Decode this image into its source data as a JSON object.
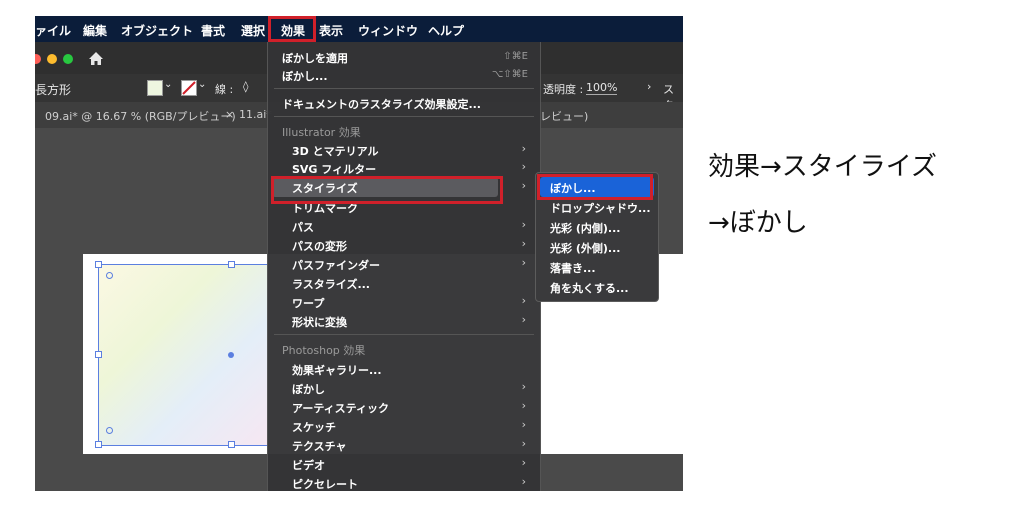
{
  "menubar": {
    "items": [
      "ァイル",
      "編集",
      "オブジェクト",
      "書式",
      "選択",
      "効果",
      "表示",
      "ウィンドウ",
      "ヘルプ"
    ]
  },
  "toolbar": {
    "shape_label": "長方形",
    "stroke_label": "線 :",
    "stroke_stepper": "◊",
    "opacity_label": "透明度 :",
    "opacity_value": "100%",
    "style_label": "スタ"
  },
  "tabs": {
    "tab1": "09.ai* @ 16.67 % (RGB/プレビュー)",
    "tab2_close": "×",
    "tab2": "11.ai*",
    "tab3_tail": "レビュー)"
  },
  "effect_menu": {
    "apply_blur": "ぼかしを適用",
    "apply_blur_shortcut": "⇧⌘E",
    "blur_dialog": "ぼかし...",
    "blur_dialog_shortcut": "⌥⇧⌘E",
    "doc_raster": "ドキュメントのラスタライズ効果設定...",
    "illustrator_header": "Illustrator 効果",
    "illustrator_items": [
      "3D とマテリアル",
      "SVG フィルター",
      "スタイライズ",
      "トリムマーク",
      "パス",
      "パスの変形",
      "パスファインダー",
      "ラスタライズ...",
      "ワープ",
      "形状に変換"
    ],
    "photoshop_header": "Photoshop 効果",
    "photoshop_items": [
      "効果ギャラリー...",
      "ぼかし",
      "アーティスティック",
      "スケッチ",
      "テクスチャ",
      "ビデオ",
      "ピクセレート"
    ]
  },
  "submenu": {
    "items": [
      "ぼかし...",
      "ドロップシャドウ...",
      "光彩 (内側)...",
      "光彩 (外側)...",
      "落書き...",
      "角を丸くする..."
    ]
  },
  "caption": {
    "line1": "効果→スタイライズ",
    "line2": "→ぼかし"
  },
  "colors": {
    "highlight_red": "#d0202a",
    "selection_blue": "#1a63d8",
    "menubar": "#0b1d3a"
  }
}
